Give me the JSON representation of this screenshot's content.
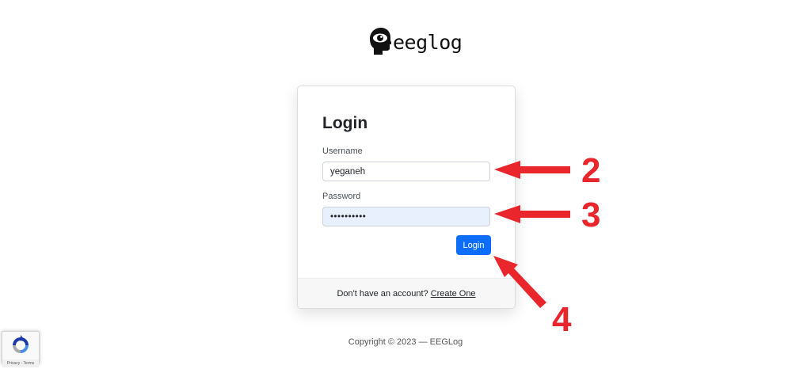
{
  "logo": {
    "text": "eeglog"
  },
  "login_card": {
    "title": "Login",
    "username_label": "Username",
    "username_value": "yeganeh",
    "password_label": "Password",
    "password_value": "••••••••••",
    "login_button_label": "Login",
    "footer_prompt": "Don't have an account?",
    "footer_link_label": "Create One"
  },
  "copyright": "Copyright © 2023 — EEGLog",
  "annotations": {
    "color": "#e8262c",
    "labels": [
      "2",
      "3",
      "4"
    ]
  },
  "recaptcha": {
    "footer_text": "Privacy - Terms"
  },
  "colors": {
    "primary": "#0d6efd",
    "autofill_bg": "#e8f0fe"
  }
}
